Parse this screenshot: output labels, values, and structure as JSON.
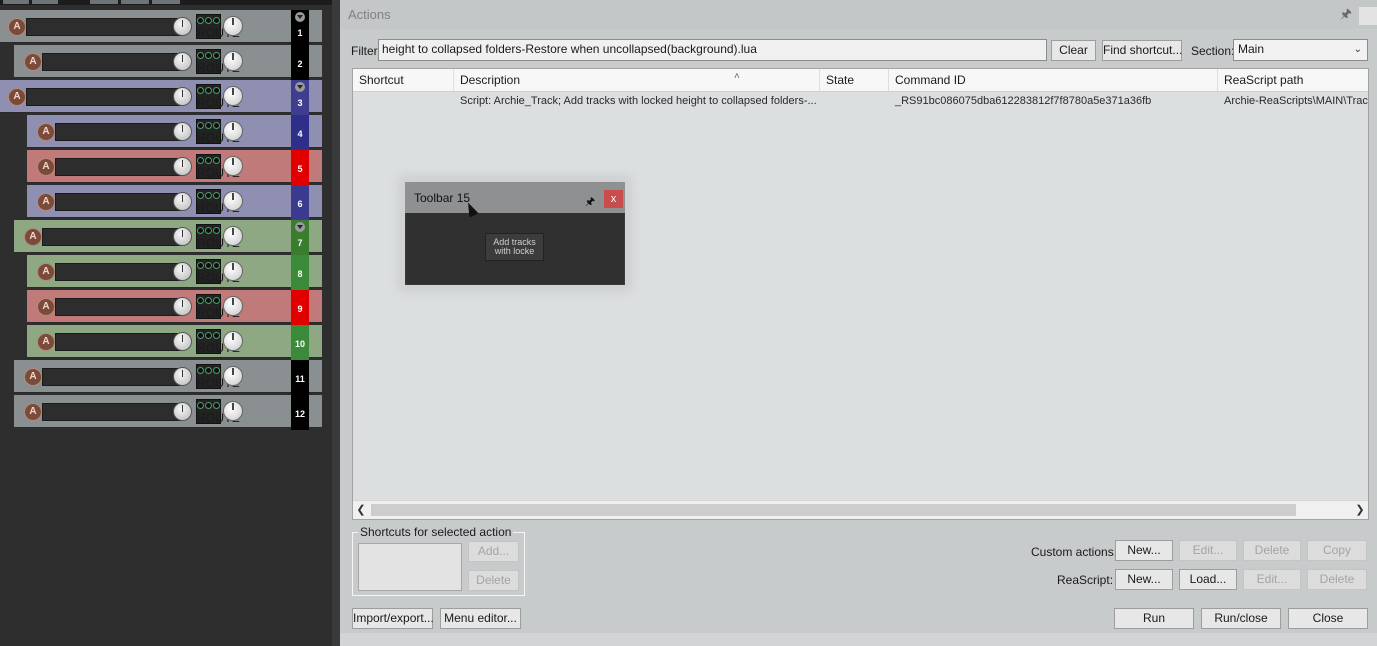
{
  "tracks": [
    {
      "number": "1",
      "num_color": "#000000",
      "fold": true,
      "color": "#8a8f91"
    },
    {
      "number": "2",
      "num_color": "#000000",
      "fold": false,
      "color": "#8a8f91"
    },
    {
      "number": "3",
      "num_color": "#3f3d8f",
      "fold": true,
      "color": "#8e8fb1"
    },
    {
      "number": "4",
      "num_color": "#2f2f8a",
      "fold": false,
      "color": "#8e8fb1"
    },
    {
      "number": "5",
      "num_color": "#e00000",
      "fold": false,
      "color": "#c07a7a"
    },
    {
      "number": "6",
      "num_color": "#3a3a8e",
      "fold": false,
      "color": "#8e8fb1"
    },
    {
      "number": "7",
      "num_color": "#3a7d2f",
      "fold": true,
      "color": "#8da883"
    },
    {
      "number": "8",
      "num_color": "#3a8a3a",
      "fold": false,
      "color": "#8da883"
    },
    {
      "number": "9",
      "num_color": "#e00000",
      "fold": false,
      "color": "#c07a7a"
    },
    {
      "number": "10",
      "num_color": "#3a8a3a",
      "fold": false,
      "color": "#8da883"
    },
    {
      "number": "11",
      "num_color": "#000000",
      "fold": false,
      "color": "#8a8f91"
    },
    {
      "number": "12",
      "num_color": "#000000",
      "fold": false,
      "color": "#8a8f91"
    }
  ],
  "track_labels": {
    "rec": "A",
    "route": "ROUTE"
  },
  "dialog": {
    "title": "Actions",
    "filter_label": "Filter:",
    "filter_value": "height to collapsed folders-Restore when uncollapsed(background).lua",
    "clear": "Clear",
    "find_shortcut": "Find shortcut...",
    "section_label": "Section:",
    "section_value": "Main"
  },
  "table": {
    "columns": [
      "Shortcut",
      "Description",
      "State",
      "Command ID",
      "ReaScript path"
    ],
    "rows": [
      {
        "shortcut": "",
        "description": "Script: Archie_Track;  Add tracks with locked height to collapsed folders-...",
        "state": "",
        "command_id": "_RS91bc086075dba612283812f7f8780a5e371a36fb",
        "path": "Archie-ReaScripts\\MAIN\\Track"
      }
    ]
  },
  "shortcuts_group": {
    "title": "Shortcuts for selected action",
    "add": "Add...",
    "delete": "Delete"
  },
  "custom_actions": {
    "label": "Custom actions:",
    "new": "New...",
    "edit": "Edit...",
    "delete": "Delete",
    "copy": "Copy"
  },
  "reascript": {
    "label": "ReaScript:",
    "new": "New...",
    "load": "Load...",
    "edit": "Edit...",
    "delete": "Delete"
  },
  "footer": {
    "import_export": "Import/export...",
    "menu_editor": "Menu editor...",
    "run": "Run",
    "run_close": "Run/close",
    "close": "Close"
  },
  "toolbar": {
    "title": "Toolbar 15",
    "close": "x",
    "button_line1": "Add tracks",
    "button_line2": "with locke"
  }
}
